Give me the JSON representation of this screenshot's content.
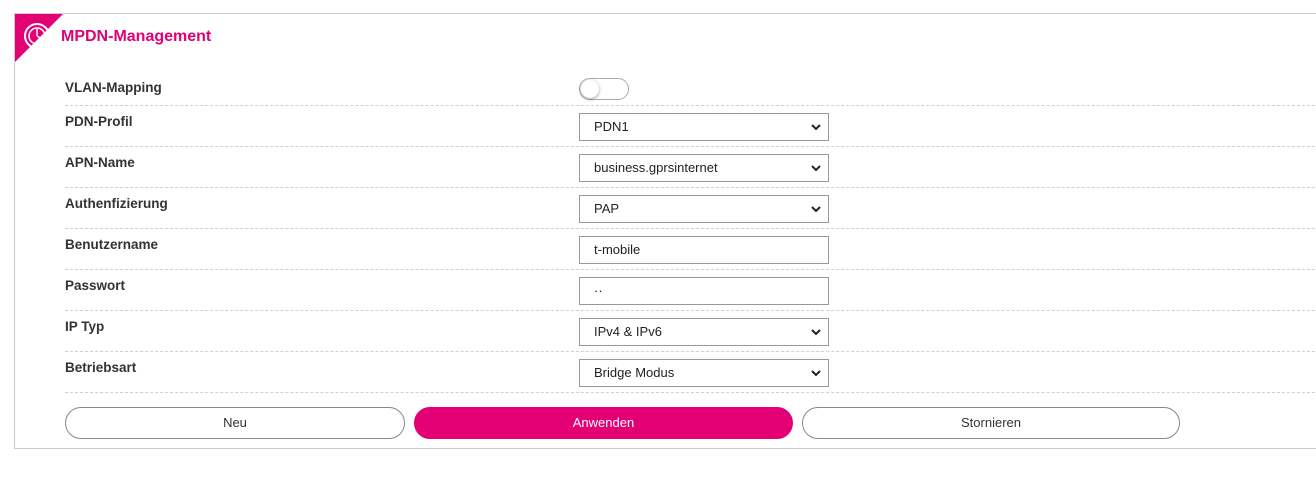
{
  "header": {
    "title": "MPDN-Management",
    "brand_color": "#e20074",
    "logo_icon": "clock-like-circle-logo"
  },
  "form": {
    "vlan_mapping": {
      "label": "VLAN-Mapping",
      "enabled": false
    },
    "pdn_profile": {
      "label": "PDN-Profil",
      "value": "PDN1"
    },
    "apn_name": {
      "label": "APN-Name",
      "value": "business.gprsinternet"
    },
    "authentication": {
      "label": "Authenfizierung",
      "value": "PAP"
    },
    "username": {
      "label": "Benutzername",
      "value": "t-mobile"
    },
    "password": {
      "label": "Passwort",
      "value": "··"
    },
    "ip_type": {
      "label": "IP Typ",
      "value": "IPv4 & IPv6"
    },
    "operating_mode": {
      "label": "Betriebsart",
      "value": "Bridge Modus"
    }
  },
  "buttons": {
    "new": "Neu",
    "apply": "Anwenden",
    "cancel": "Stornieren"
  }
}
